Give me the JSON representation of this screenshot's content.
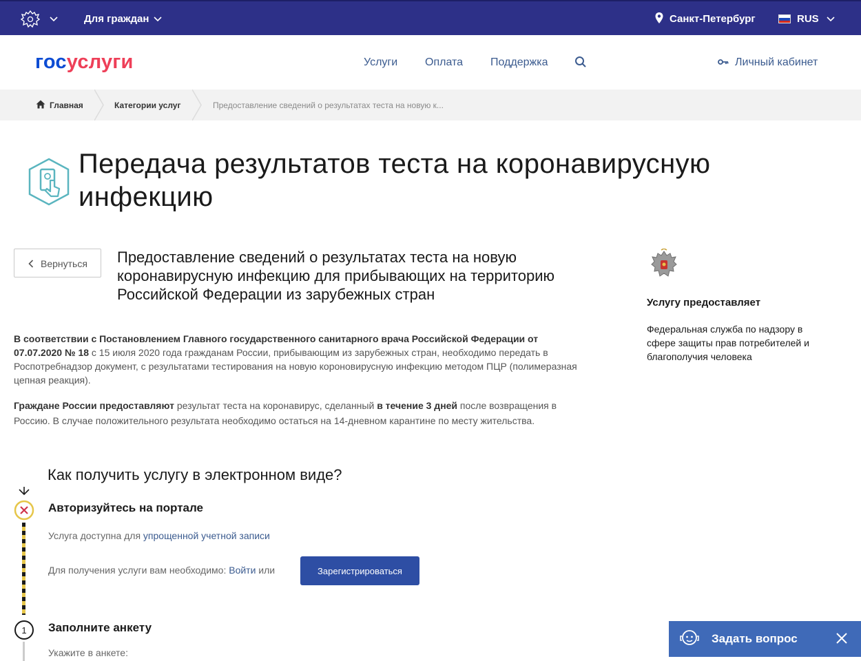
{
  "topbar": {
    "audience": "Для граждан",
    "city": "Санкт-Петербург",
    "language": "RUS"
  },
  "header": {
    "logo_part1": "гос",
    "logo_part2": "услуги",
    "nav": [
      "Услуги",
      "Оплата",
      "Поддержка"
    ],
    "cabinet": "Личный кабинет"
  },
  "breadcrumb": {
    "home": "Главная",
    "categories": "Категории услуг",
    "current": "Предоставление сведений о результатах теста на новую к..."
  },
  "page": {
    "title": "Передача результатов теста на коронавирусную инфекцию",
    "back_label": "Вернуться",
    "service_title": "Предоставление сведений о результатах теста на новую коронавирусную инфекцию для прибывающих на территорию Российской Федерации из зарубежных стран",
    "desc1_bold": "В соответствии с Постановлением Главного государственного санитарного врача Российской Федерации от 07.07.2020 № 18",
    "desc1_rest": " с 15 июля 2020 года гражданам России, прибывающим из зарубежных стран, необходимо передать в Роспотребнадзор документ, с результатами тестирования на новую короновирусную инфекцию методом ПЦР (полимеразная цепная реакция).",
    "desc2_bold1": "Граждане России предоставляют",
    "desc2_mid": " результат теста на коронавирус, сделанный ",
    "desc2_bold2": "в течение 3 дней",
    "desc2_rest": " после возвращения в Россию. В случае положительного результата необходимо остаться на 14-дневном карантине по месту жительства."
  },
  "provider": {
    "label": "Услугу предоставляет",
    "name": "Федеральная служба по надзору в сфере защиты прав потребителей и благополучия человека"
  },
  "steps": {
    "title": "Как получить услугу в электронном виде?",
    "step1_title": "Авторизуйтесь на портале",
    "step1_text": "Услуга доступна для ",
    "step1_link": "упрощенной учетной записи",
    "step1_login_text": "Для получения услуги вам необходимо: ",
    "step1_login_link": "Войти",
    "step1_or": " или",
    "register_button": "Зарегистрироваться",
    "step2_number": "1",
    "step2_title": "Заполните анкету",
    "step2_text": "Укажите в анкете:"
  },
  "widget": {
    "label": "Задать вопрос"
  },
  "colors": {
    "topbar": "#2d3088",
    "logo_blue": "#0d4cd3",
    "logo_red": "#ee3f58",
    "link": "#3b5b8f",
    "button": "#2e4ea4",
    "widget": "#3f6ab8",
    "step_accent": "#e6c64a",
    "step_error": "#d0344a"
  }
}
